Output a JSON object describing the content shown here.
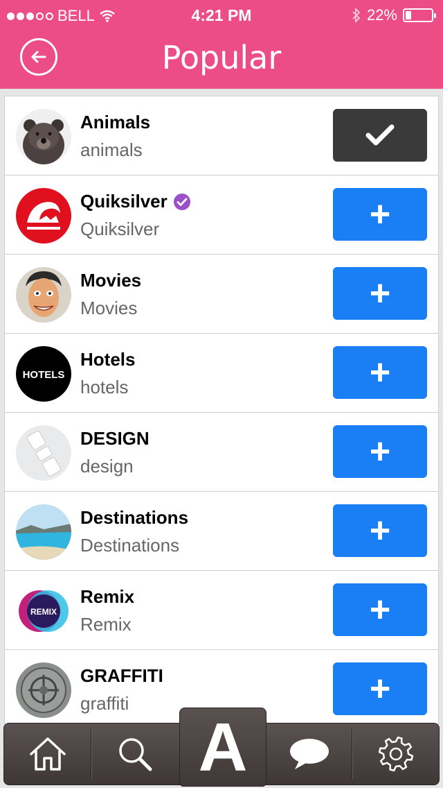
{
  "status_bar": {
    "carrier": "BELL",
    "time": "4:21 PM",
    "battery": "22%",
    "battery_level": 0.22,
    "signal_bars_filled": 3,
    "signal_bars_total": 5
  },
  "header": {
    "title": "Popular",
    "back_icon": "back-arrow-icon",
    "color": "#ec4d85"
  },
  "list": [
    {
      "name": "Animals",
      "handle": "animals",
      "verified": false,
      "followed": true,
      "avatar": "bear"
    },
    {
      "name": "Quiksilver",
      "handle": "Quiksilver",
      "verified": true,
      "followed": false,
      "avatar": "quiksilver-logo"
    },
    {
      "name": "Movies",
      "handle": "Movies",
      "verified": false,
      "followed": false,
      "avatar": "retro-face"
    },
    {
      "name": "Hotels",
      "handle": "hotels",
      "verified": false,
      "followed": false,
      "avatar": "hotels-badge",
      "avatar_text": "HOTELS"
    },
    {
      "name": "DESIGN",
      "handle": "design",
      "verified": false,
      "followed": false,
      "avatar": "design-items"
    },
    {
      "name": "Destinations",
      "handle": "Destinations",
      "verified": false,
      "followed": false,
      "avatar": "beach-lake"
    },
    {
      "name": "Remix",
      "handle": "Remix",
      "verified": false,
      "followed": false,
      "avatar": "remix-badge",
      "avatar_text": "REMIX"
    },
    {
      "name": "GRAFFITI",
      "handle": "graffiti",
      "verified": false,
      "followed": false,
      "avatar": "graffiti-manhole"
    }
  ],
  "actions": {
    "add_symbol": "+",
    "added_symbol": "✔",
    "add_color": "#1a7ff5",
    "added_color": "#3a3a3a"
  },
  "tab_bar": {
    "tabs": [
      {
        "icon": "home-icon"
      },
      {
        "icon": "search-icon"
      },
      {
        "icon": "logo-a-icon",
        "label": "A"
      },
      {
        "icon": "chat-bubble-icon"
      },
      {
        "icon": "gear-icon"
      }
    ]
  }
}
